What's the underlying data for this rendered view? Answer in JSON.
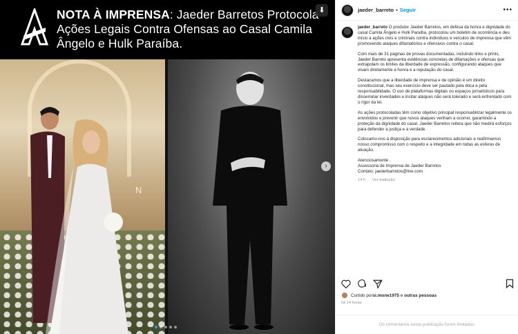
{
  "media": {
    "headline_bold": "NOTA À IMPRENSA",
    "headline_rest": ": Jaeder Barretos Protocola Ações Legais Contra Ofensas ao Casal Camila Ângelo e Hulk Paraíba.",
    "watermark_glyph": "N",
    "next_glyph": "›",
    "download_glyph": "⬇",
    "carousel_dots": 5,
    "active_dot": 0
  },
  "post": {
    "username": "jaeder_barreto",
    "separator": "•",
    "follow_label": "Seguir",
    "more_glyph": "•••",
    "caption_username": "jaeder_barreto",
    "caption_paragraphs": [
      "O produtor Jaeder Barretos, em defesa da honra e dignidade do casal Camila Ângelo e Hulk Paraíba, protocolou um boletim de ocorrência e deu início a ações civis e criminais contra indivíduos e veículos de imprensa que vêm promovendo ataques difamatórios e ofensivos contra o casal.",
      "Com mais de 31 páginas de provas documentadas, incluindo links e prints, Jaeder Barreto apresenta evidências concretas de difamações e ofensas que extrapolam os limites da liberdade de expressão, configurando ataques que visam diretamente a honra e a reputação do casal.",
      "Destacamos que a liberdade de imprensa e de opinião é um direito constitucional, mas seu exercício deve ser pautado pela ética e pela responsabilidade. O uso de plataformas digitais ou espaços jornalísticos para disseminar inverdades e incitar ataques não será tolerado e será enfrentado com o rigor da lei.",
      "As ações protocoladas têm como objetivo principal responsabilizar legalmente os envolvidos e prevenir que novos ataques venham a ocorrer, garantindo a proteção da dignidade do casal. Jaeder Barretos reitera que não medirá esforços para defender a justiça e a verdade.",
      "Colocamo-nos à disposição para esclarecimentos adicionais e reafirmamos nosso compromisso com o respeito e a integridade em todas as esferas de atuação.",
      "Atenciosamente ,\nAssessoria de Imprensa de Jaeder Barretos\nContato: jaederbarretos@live.com"
    ],
    "caption_age": "14 h",
    "translate_label": "Ver tradução",
    "liked_prefix": "Curtido por ",
    "liked_user": "si.mone1975",
    "liked_suffix": " e ",
    "liked_others": "outras pessoas",
    "timestamp": "há 14 horas",
    "comments_disabled": "Os comentários nesta publicação foram limitados."
  },
  "icons": {
    "like": "heart-icon",
    "comment": "comment-icon",
    "share": "share-icon",
    "save": "bookmark-icon",
    "accent": "#0095f6"
  }
}
